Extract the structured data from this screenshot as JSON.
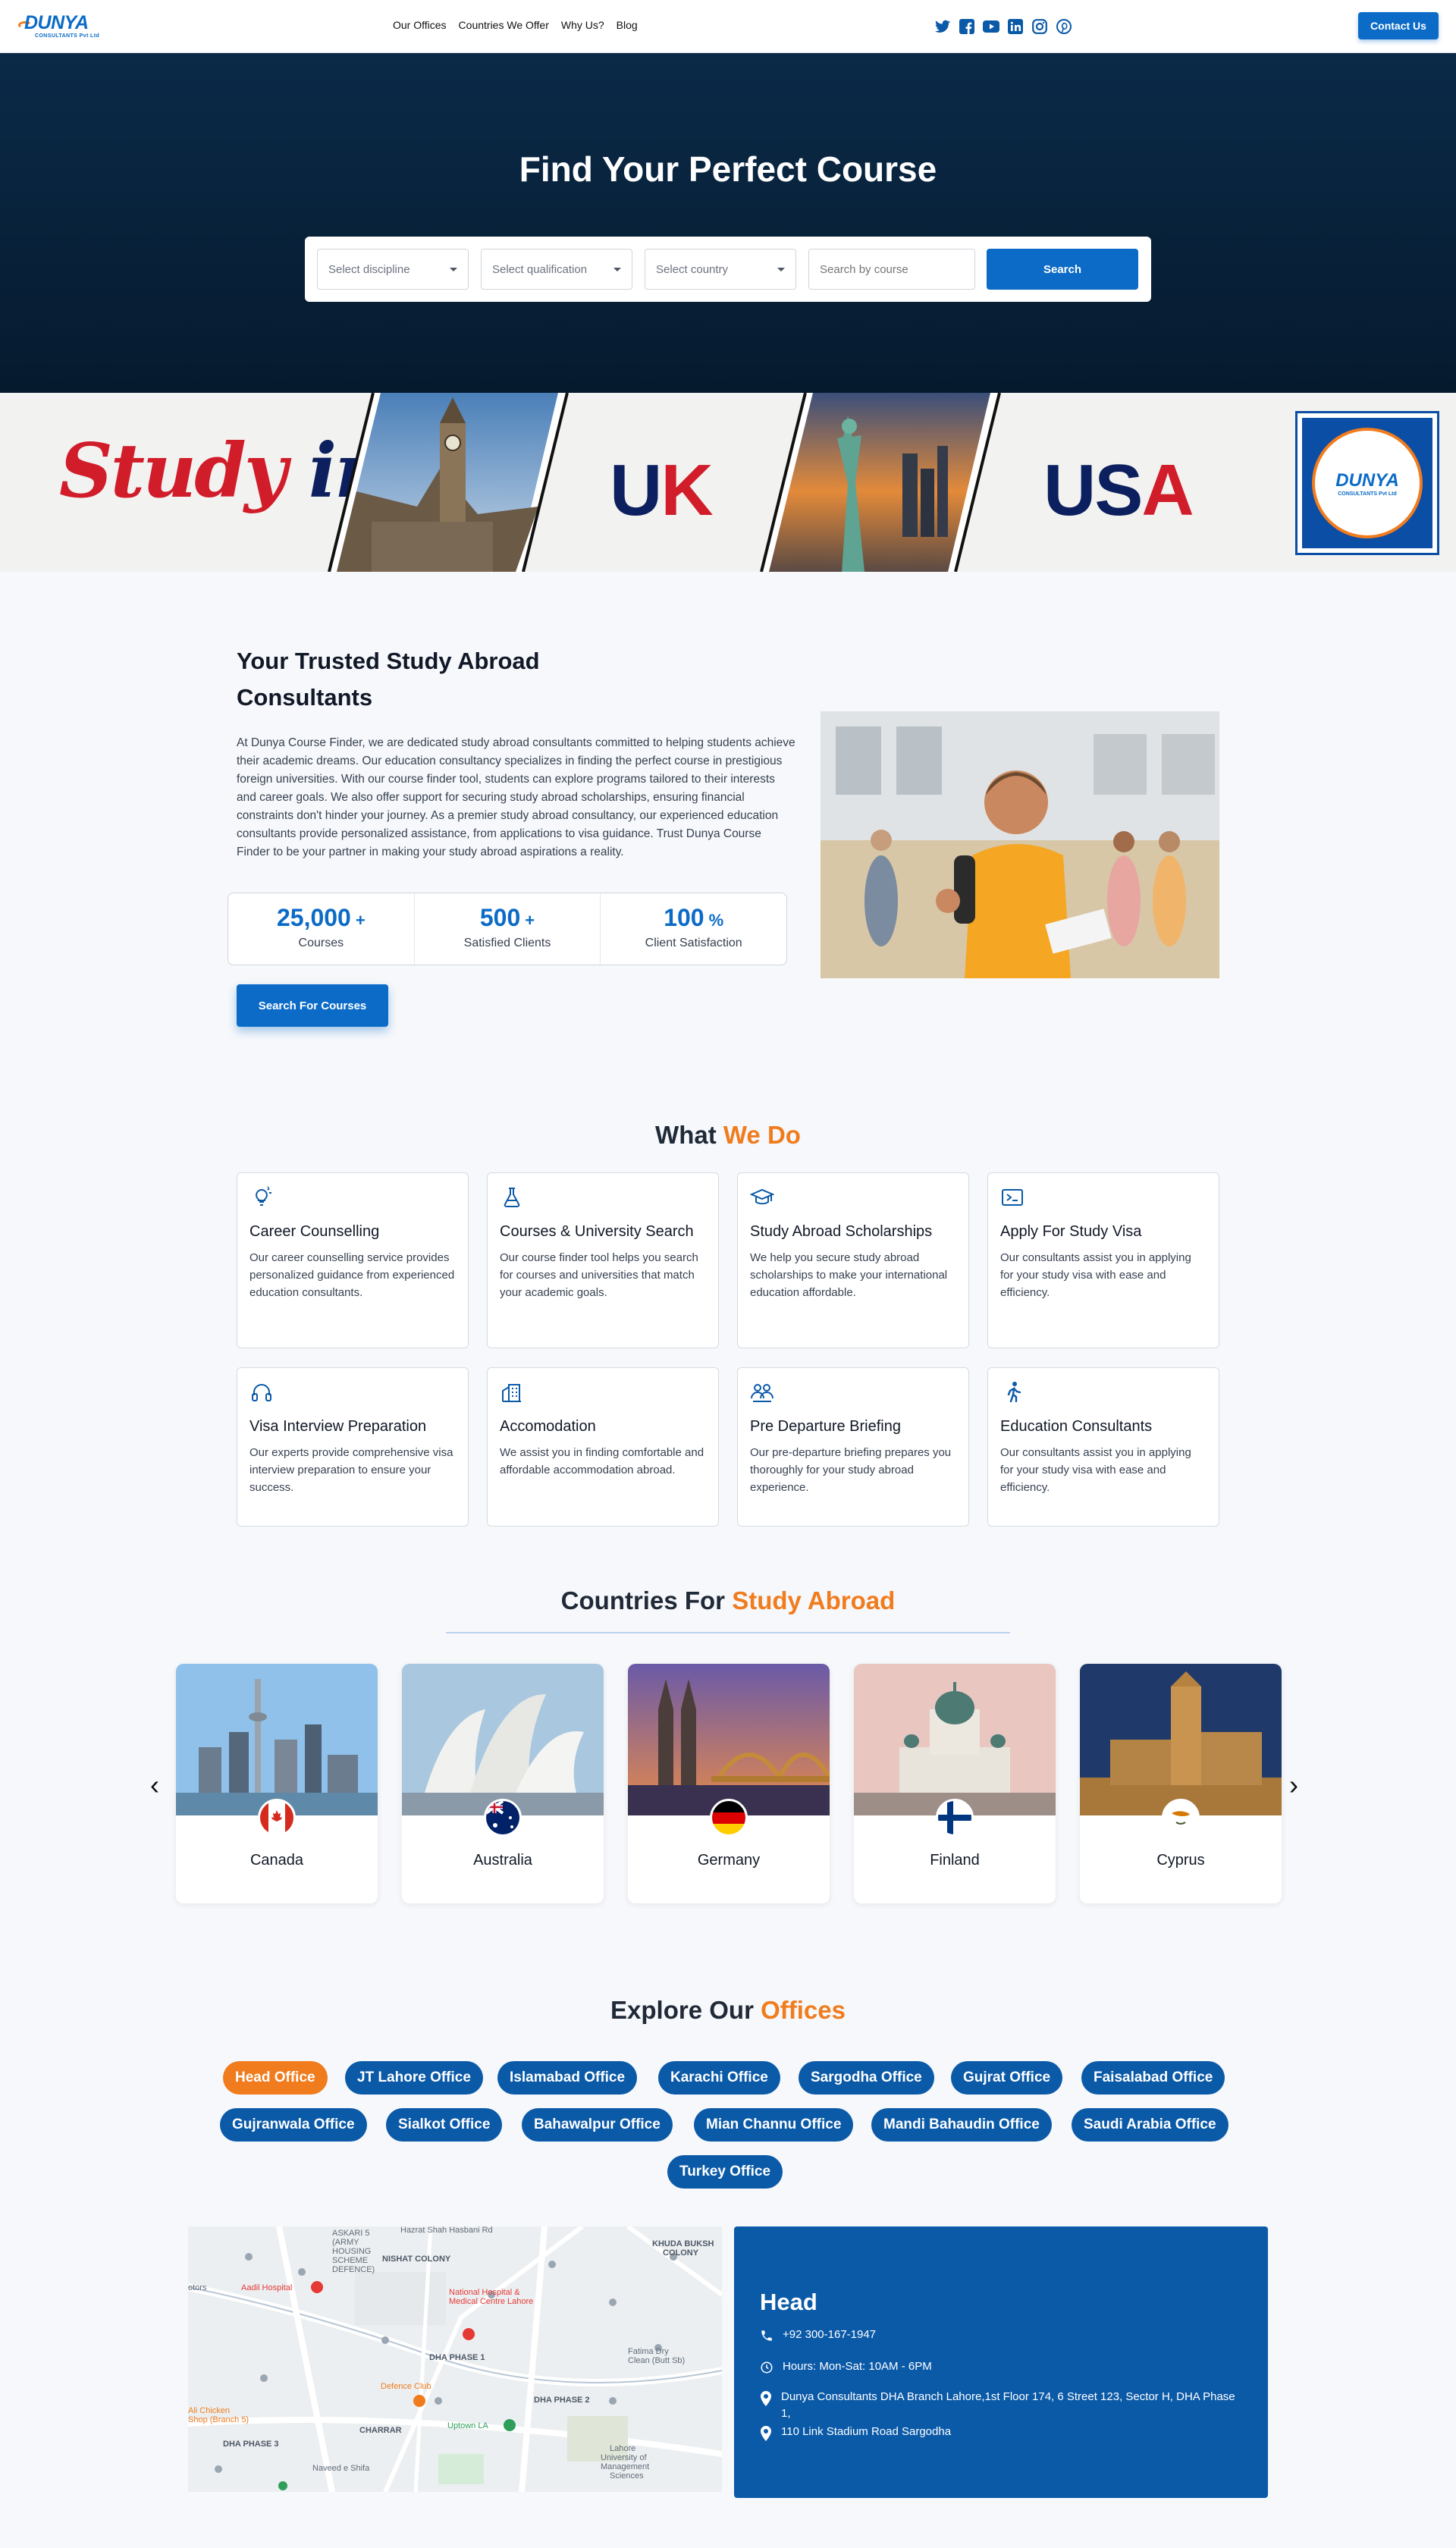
{
  "brand": {
    "name": "DUNYA",
    "sub": "CONSULTANTS Pvt Ltd"
  },
  "nav": {
    "links": [
      "Our Offices",
      "Countries We Offer",
      "Why Us?",
      "Blog"
    ],
    "contact": "Contact Us"
  },
  "socials": [
    "twitter-icon",
    "facebook-icon",
    "youtube-icon",
    "linkedin-icon",
    "instagram-icon",
    "pinterest-icon"
  ],
  "hero": {
    "title": "Find Your Perfect Course",
    "discipline": "Select discipline",
    "qualification": "Select qualification",
    "country": "Select country",
    "search_placeholder": "Search by course",
    "search_button": "Search"
  },
  "banner": {
    "study": "Study",
    "in": "in",
    "uk_u": "U",
    "uk_k": "K",
    "usa_us": "US",
    "usa_a": "A"
  },
  "about": {
    "title": "Your Trusted Study Abroad Consultants",
    "body": "At Dunya Course Finder, we are dedicated study abroad consultants committed to helping students achieve their academic dreams. Our education consultancy specializes in finding the perfect course in prestigious foreign universities. With our course finder tool, students can explore programs tailored to their interests and career goals. We also offer support for securing study abroad scholarships, ensuring financial constraints don't hinder your journey. As a premier study abroad consultancy, our experienced education consultants provide personalized assistance, from applications to visa guidance. Trust Dunya Course Finder to be your partner in making your study abroad aspirations a reality.",
    "stats": [
      {
        "value": "25,000",
        "suffix": "+",
        "label": "Courses"
      },
      {
        "value": "500",
        "suffix": "+",
        "label": "Satisfied Clients"
      },
      {
        "value": "100",
        "suffix": "%",
        "label": "Client Satisfaction"
      }
    ],
    "button": "Search For Courses"
  },
  "what_we_do": {
    "title_a": "What ",
    "title_b": "We Do",
    "cards": [
      {
        "icon": "lightbulb-icon",
        "title": "Career Counselling",
        "desc": "Our career counselling service provides personalized guidance from experienced education consultants."
      },
      {
        "icon": "flask-icon",
        "title": "Courses & University Search",
        "desc": "Our course finder tool helps you search for courses and universities that match your academic goals."
      },
      {
        "icon": "graduation-cap-icon",
        "title": "Study Abroad Scholarships",
        "desc": "We help you secure study abroad scholarships to make your international education affordable."
      },
      {
        "icon": "passport-icon",
        "title": "Apply For Study Visa",
        "desc": "Our consultants assist you in applying for your study visa with ease and efficiency."
      },
      {
        "icon": "headset-icon",
        "title": "Visa Interview Preparation",
        "desc": "Our experts provide comprehensive visa interview preparation to ensure your success."
      },
      {
        "icon": "building-icon",
        "title": "Accomodation",
        "desc": "We assist you in finding comfortable and affordable accommodation abroad."
      },
      {
        "icon": "group-icon",
        "title": "Pre Departure Briefing",
        "desc": "Our pre-departure briefing prepares you thoroughly for your study abroad experience."
      },
      {
        "icon": "person-walking-icon",
        "title": "Education Consultants",
        "desc": "Our consultants assist you in applying for your study visa with ease and efficiency."
      }
    ]
  },
  "countries": {
    "title_a": "Countries For ",
    "title_b": "Study Abroad",
    "items": [
      "Canada",
      "Australia",
      "Germany",
      "Finland",
      "Cyprus"
    ]
  },
  "offices": {
    "title_a": "Explore Our ",
    "title_b": "Offices",
    "pills": [
      "Head Office",
      "JT Lahore Office",
      "Islamabad Office",
      "Karachi Office",
      "Sargodha Office",
      "Gujrat Office",
      "Faisalabad Office",
      "Gujranwala Office",
      "Sialkot Office",
      "Bahawalpur Office",
      "Mian Channu Office",
      "Mandi Bahaudin Office",
      "Saudi Arabia Office",
      "Turkey Office"
    ],
    "active": "Head Office",
    "info": {
      "title": "Head",
      "phone": "+92 300-167-1947",
      "hours": "Hours: Mon-Sat: 10AM - 6PM",
      "address1": "Dunya Consultants DHA Branch Lahore,1st Floor 174, 6 Street 123, Sector H, DHA Phase 1,",
      "address2": "110 Link Stadium Road Sargodha"
    }
  },
  "map_labels": {
    "l1": "Hazrat Shah Hasbani Rd",
    "l2": "ASKARI 5",
    "l3": "(ARMY",
    "l4": "HOUSING",
    "l5": "SCHEME",
    "l6": "DEFENCE)",
    "l7": "NISHAT COLONY",
    "l8": "KHUDA BUKSH",
    "l9": "COLONY",
    "l10": "Aadil Hospital",
    "l11": "National Hospital &",
    "l12": "Medical Centre Lahore",
    "l13": "DHA PHASE 1",
    "l14": "Fatima Dry",
    "l15": "Clean (Butt Sb)",
    "l16": "DHA PHASE 2",
    "l17": "Defence Club",
    "l18": "Uptown LA",
    "l19": "CHARRAR",
    "l20": "DHA PHASE 3",
    "l21": "Naveed e Shifa",
    "l22": "Lahore",
    "l23": "University of",
    "l24": "Management",
    "l25": "Sciences",
    "l26": "Ali Chicken",
    "l27": "Shop (Branch 5)",
    "l28": "otors"
  }
}
